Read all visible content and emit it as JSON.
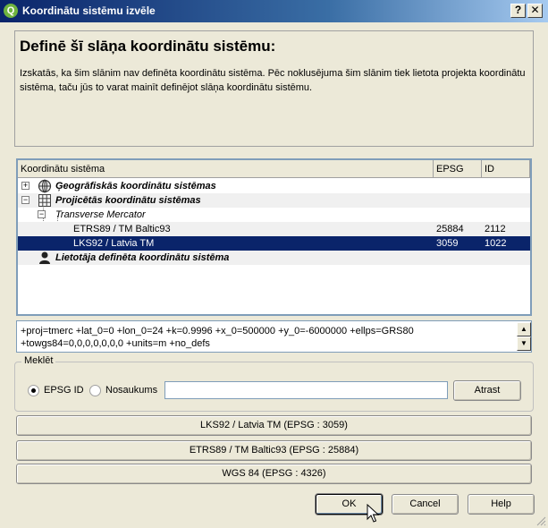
{
  "window": {
    "title": "Koordinātu sistēmu izvēle",
    "app_icon_letter": "Q",
    "help_glyph": "?",
    "close_glyph": "✕"
  },
  "info": {
    "heading": "Definē šī slāņa koordinātu sistēmu:",
    "text": "Izskatās, ka šim slānim nav definēta koordinātu sistēma. Pēc noklusējuma šim slānim tiek lietota projekta koordinātu sistēma, taču jūs to varat mainīt definējot slāņa koordinātu sistēmu."
  },
  "tree": {
    "columns": [
      "Koordinātu sistēma",
      "EPSG",
      "ID"
    ],
    "rows": [
      {
        "label": "Ģeogrāfiskās koordinātu sistēmas",
        "epsg": "",
        "id": "",
        "icon": "globe-icon"
      },
      {
        "label": "Projicētās koordinātu sistēmas",
        "epsg": "",
        "id": "",
        "icon": "grid-icon"
      },
      {
        "label": "Transverse Mercator",
        "epsg": "",
        "id": ""
      },
      {
        "label": "ETRS89 / TM Baltic93",
        "epsg": "25884",
        "id": "2112"
      },
      {
        "label": "LKS92 / Latvia TM",
        "epsg": "3059",
        "id": "1022",
        "selected": true
      },
      {
        "label": "Lietotāja definēta koordinātu sistēma",
        "epsg": "",
        "id": "",
        "icon": "user-icon"
      }
    ],
    "expander_plus": "+",
    "expander_minus": "−"
  },
  "proj_string": "+proj=tmerc +lat_0=0 +lon_0=24 +k=0.9996 +x_0=500000 +y_0=-6000000 +ellps=GRS80 +towgs84=0,0,0,0,0,0,0 +units=m +no_defs",
  "search": {
    "legend": "Meklēt",
    "radio_epsg_label": "EPSG ID",
    "radio_name_label": "Nosaukums",
    "selected": "EPSG ID",
    "input_value": "",
    "find_button": "Atrast"
  },
  "recent": [
    "LKS92 / Latvia TM (EPSG : 3059)",
    "ETRS89 / TM Baltic93 (EPSG : 25884)",
    "WGS 84 (EPSG : 4326)"
  ],
  "buttons": {
    "ok": "OK",
    "cancel": "Cancel",
    "help": "Help"
  },
  "colors": {
    "selection": "#0a246a",
    "title_gradient_start": "#0a246a",
    "window_bg": "#ece9d8"
  }
}
